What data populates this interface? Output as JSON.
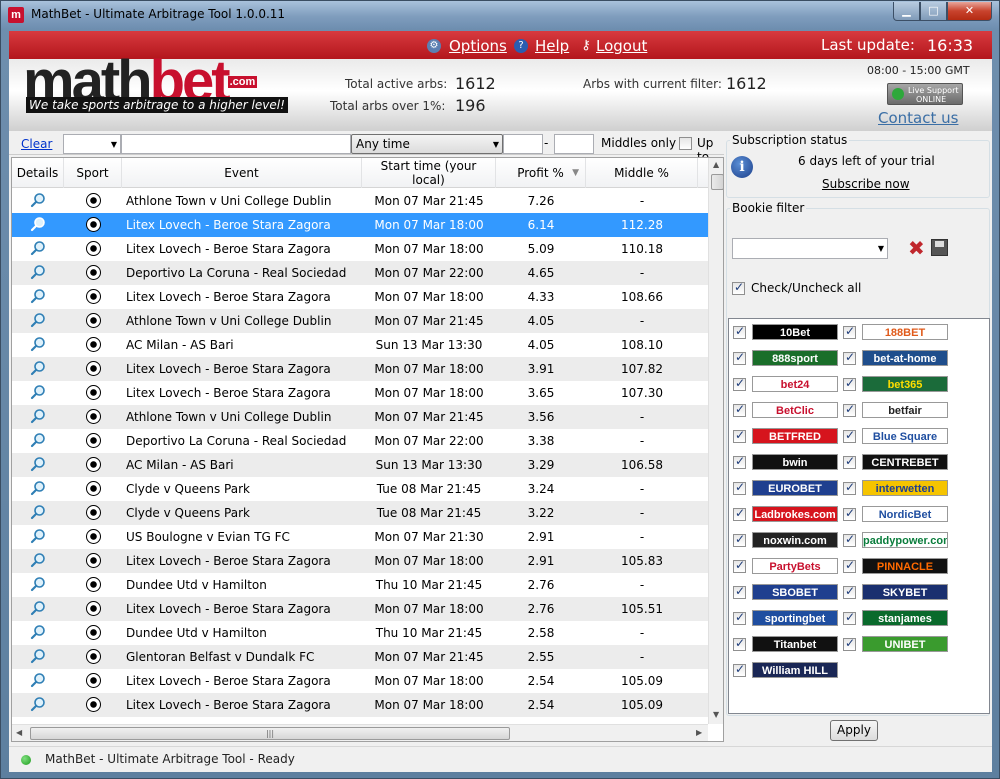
{
  "window": {
    "title": "MathBet - Ultimate Arbitrage Tool 1.0.0.11",
    "min": "▁",
    "max": "□",
    "close": "✕"
  },
  "nav": {
    "options": "Options",
    "help": "Help",
    "logout": "Logout"
  },
  "header": {
    "last_update_label": "Last update:",
    "last_update_time": "16:33",
    "logo_math": "math",
    "logo_bet": "bet",
    "logo_com": ".com",
    "tagline": "We take sports arbitrage to a higher level!",
    "total_active_label": "Total active arbs:",
    "total_active_value": "1612",
    "total_over_label": "Total arbs over 1%:",
    "total_over_value": "196",
    "filter_label": "Arbs with current filter:",
    "filter_value": "1612",
    "hours": "08:00 - 15:00 GMT",
    "live_support_line1": "Live Support",
    "live_support_line2": "ONLINE",
    "contact": "Contact us"
  },
  "filter": {
    "clear": "Clear",
    "time_select": "Any time",
    "dash": "-",
    "middles_only": "Middles only",
    "up_to": "Up to"
  },
  "table": {
    "headers": [
      "Details",
      "Sport",
      "Event",
      "Start time (your local)",
      "Profit %",
      "Middle %"
    ],
    "rows": [
      {
        "event": "Athlone Town v Uni College Dublin",
        "time": "Mon 07 Mar 21:45",
        "profit": "7.26",
        "middle": "-"
      },
      {
        "event": "Litex Lovech - Beroe Stara Zagora",
        "time": "Mon 07 Mar 18:00",
        "profit": "6.14",
        "middle": "112.28"
      },
      {
        "event": "Litex Lovech - Beroe Stara Zagora",
        "time": "Mon 07 Mar 18:00",
        "profit": "5.09",
        "middle": "110.18"
      },
      {
        "event": "Deportivo La Coruna - Real Sociedad",
        "time": "Mon 07 Mar 22:00",
        "profit": "4.65",
        "middle": "-"
      },
      {
        "event": "Litex Lovech - Beroe Stara Zagora",
        "time": "Mon 07 Mar 18:00",
        "profit": "4.33",
        "middle": "108.66"
      },
      {
        "event": "Athlone Town v Uni College Dublin",
        "time": "Mon 07 Mar 21:45",
        "profit": "4.05",
        "middle": "-"
      },
      {
        "event": "AC Milan - AS Bari",
        "time": "Sun 13 Mar 13:30",
        "profit": "4.05",
        "middle": "108.10"
      },
      {
        "event": "Litex Lovech - Beroe Stara Zagora",
        "time": "Mon 07 Mar 18:00",
        "profit": "3.91",
        "middle": "107.82"
      },
      {
        "event": "Litex Lovech - Beroe Stara Zagora",
        "time": "Mon 07 Mar 18:00",
        "profit": "3.65",
        "middle": "107.30"
      },
      {
        "event": "Athlone Town v Uni College Dublin",
        "time": "Mon 07 Mar 21:45",
        "profit": "3.56",
        "middle": "-"
      },
      {
        "event": "Deportivo La Coruna - Real Sociedad",
        "time": "Mon 07 Mar 22:00",
        "profit": "3.38",
        "middle": "-"
      },
      {
        "event": "AC Milan - AS Bari",
        "time": "Sun 13 Mar 13:30",
        "profit": "3.29",
        "middle": "106.58"
      },
      {
        "event": "Clyde v Queens Park",
        "time": "Tue 08 Mar 21:45",
        "profit": "3.24",
        "middle": "-"
      },
      {
        "event": "Clyde v Queens Park",
        "time": "Tue 08 Mar 21:45",
        "profit": "3.22",
        "middle": "-"
      },
      {
        "event": "US Boulogne v Evian TG FC",
        "time": "Mon 07 Mar 21:30",
        "profit": "2.91",
        "middle": "-"
      },
      {
        "event": "Litex Lovech - Beroe Stara Zagora",
        "time": "Mon 07 Mar 18:00",
        "profit": "2.91",
        "middle": "105.83"
      },
      {
        "event": "Dundee Utd v Hamilton",
        "time": "Thu 10 Mar 21:45",
        "profit": "2.76",
        "middle": "-"
      },
      {
        "event": "Litex Lovech - Beroe Stara Zagora",
        "time": "Mon 07 Mar 18:00",
        "profit": "2.76",
        "middle": "105.51"
      },
      {
        "event": "Dundee Utd v Hamilton",
        "time": "Thu 10 Mar 21:45",
        "profit": "2.58",
        "middle": "-"
      },
      {
        "event": "Glentoran Belfast v Dundalk FC",
        "time": "Mon 07 Mar 21:45",
        "profit": "2.55",
        "middle": "-"
      },
      {
        "event": "Litex Lovech - Beroe Stara Zagora",
        "time": "Mon 07 Mar 18:00",
        "profit": "2.54",
        "middle": "105.09"
      },
      {
        "event": "Litex Lovech - Beroe Stara Zagora",
        "time": "Mon 07 Mar 18:00",
        "profit": "2.54",
        "middle": "105.09"
      }
    ],
    "selected_row": 1
  },
  "sidebar": {
    "subscription_title": "Subscription status",
    "trial_text": "6 days left of your trial",
    "subscribe": "Subscribe now",
    "bookie_title": "Bookie filter",
    "check_all": "Check/Uncheck all",
    "apply": "Apply",
    "bookies": [
      {
        "name": "10Bet",
        "bg": "#000000",
        "fg": "#ffffff"
      },
      {
        "name": "188BET",
        "bg": "#ffffff",
        "fg": "#e05a1a"
      },
      {
        "name": "888sport",
        "bg": "#1a6e2a",
        "fg": "#ffffff"
      },
      {
        "name": "bet-at-home",
        "bg": "#1f4e8c",
        "fg": "#ffffff"
      },
      {
        "name": "bet24",
        "bg": "#ffffff",
        "fg": "#c8102e"
      },
      {
        "name": "bet365",
        "bg": "#1b6b3a",
        "fg": "#ffde00"
      },
      {
        "name": "BetClic",
        "bg": "#ffffff",
        "fg": "#c8102e"
      },
      {
        "name": "betfair",
        "bg": "#ffffff",
        "fg": "#222222"
      },
      {
        "name": "BETFRED",
        "bg": "#d6141d",
        "fg": "#ffffff"
      },
      {
        "name": "Blue Square",
        "bg": "#ffffff",
        "fg": "#1f4ea0"
      },
      {
        "name": "bwin",
        "bg": "#111111",
        "fg": "#ffffff"
      },
      {
        "name": "CENTREBET",
        "bg": "#111111",
        "fg": "#ffffff"
      },
      {
        "name": "EUROBET",
        "bg": "#1f3f8f",
        "fg": "#ffffff"
      },
      {
        "name": "interwetten",
        "bg": "#f5c400",
        "fg": "#1f3f8f"
      },
      {
        "name": "Ladbrokes.com",
        "bg": "#d6141d",
        "fg": "#ffffff"
      },
      {
        "name": "NordicBet",
        "bg": "#ffffff",
        "fg": "#1f4ea0"
      },
      {
        "name": "noxwin.com",
        "bg": "#222222",
        "fg": "#ffffff"
      },
      {
        "name": "paddypower.com",
        "bg": "#ffffff",
        "fg": "#0a7d3c"
      },
      {
        "name": "PartyBets",
        "bg": "#ffffff",
        "fg": "#c8102e"
      },
      {
        "name": "PINNACLE",
        "bg": "#111111",
        "fg": "#ff6a00"
      },
      {
        "name": "SBOBET",
        "bg": "#1f3f8f",
        "fg": "#ffffff"
      },
      {
        "name": "SKYBET",
        "bg": "#1a2f6f",
        "fg": "#ffffff"
      },
      {
        "name": "sportingbet",
        "bg": "#1f4ea0",
        "fg": "#ffffff"
      },
      {
        "name": "stanjames",
        "bg": "#0a6a2c",
        "fg": "#ffffff"
      },
      {
        "name": "Titanbet",
        "bg": "#111111",
        "fg": "#ffffff"
      },
      {
        "name": "UNIBET",
        "bg": "#3a9b2e",
        "fg": "#ffffff"
      },
      {
        "name": "William HILL",
        "bg": "#1a2755",
        "fg": "#ffffff"
      }
    ]
  },
  "status": {
    "text": "MathBet - Ultimate Arbitrage Tool - Ready"
  }
}
